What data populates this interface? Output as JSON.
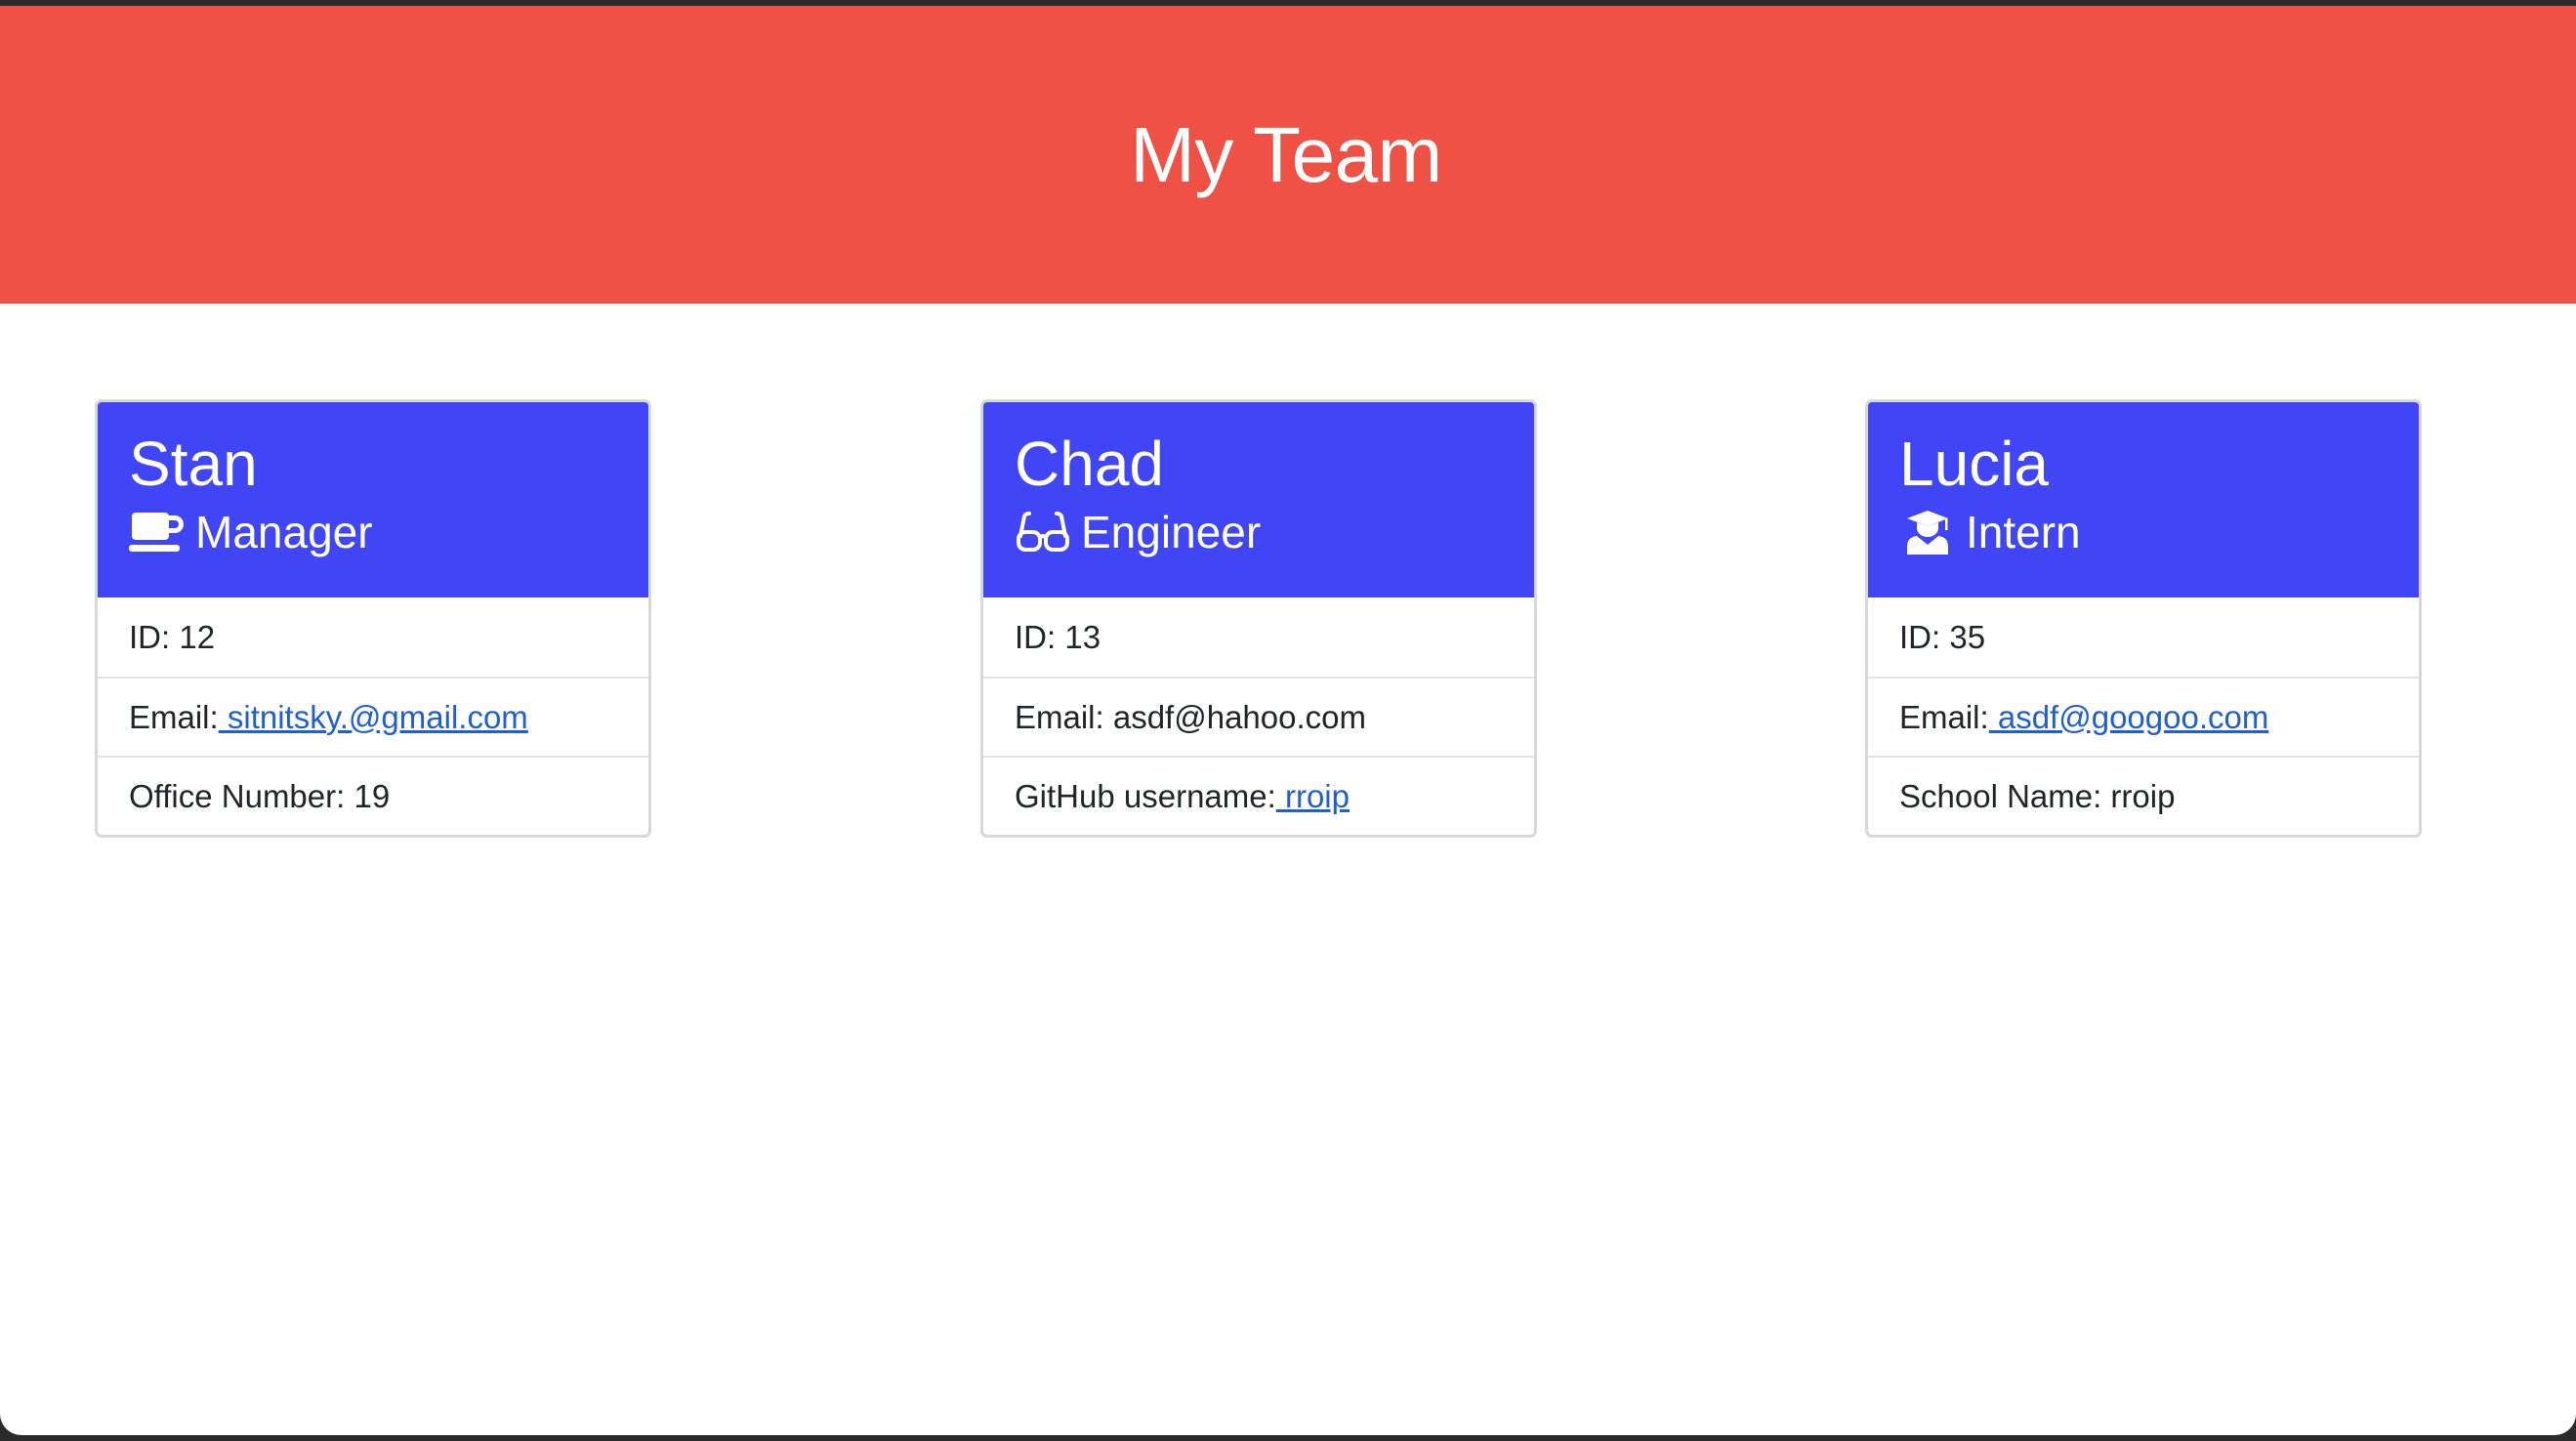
{
  "header": {
    "title": "My Team"
  },
  "colors": {
    "header_bg": "#ef5145",
    "card_header_bg": "#4045f5",
    "link": "#1f5fd6"
  },
  "cards": [
    {
      "name": "Stan",
      "role": "Manager",
      "role_icon": "coffee-mug-icon",
      "id_text": "ID: 12",
      "email_label": "Email:",
      "email_value": " sitnitsky.@gmail.com",
      "extra_label": "Office Number: 19",
      "extra_link": ""
    },
    {
      "name": "Chad",
      "role": "Engineer",
      "role_icon": "glasses-icon",
      "id_text": "ID: 13",
      "email_label": "Email: asdf@hahoo.com",
      "email_value": "",
      "extra_label": "GitHub username:",
      "extra_link": " rroip"
    },
    {
      "name": "Lucia",
      "role": "Intern",
      "role_icon": "graduate-icon",
      "id_text": "ID: 35",
      "email_label": "Email:",
      "email_value": " asdf@googoo.com",
      "extra_label": "School Name: rroip",
      "extra_link": ""
    }
  ]
}
